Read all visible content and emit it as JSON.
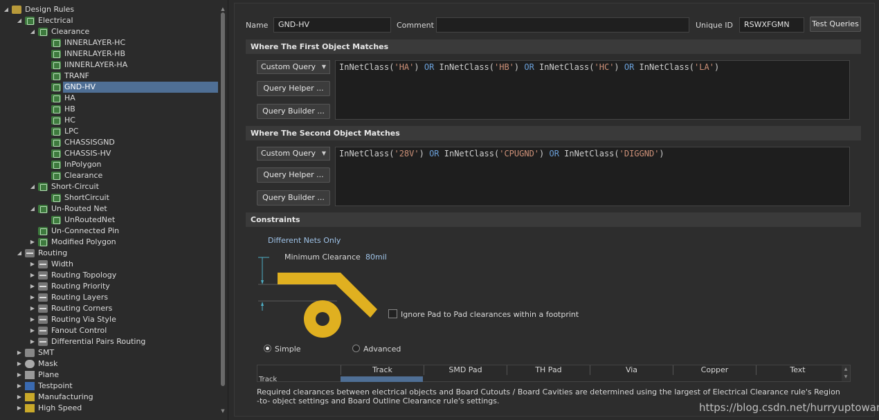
{
  "tree": {
    "root": "Design Rules",
    "electrical": "Electrical",
    "clearance": "Clearance",
    "clearance_rules": [
      "INNERLAYER-HC",
      "INNERLAYER-HB",
      "IINNERLAYER-HA",
      "TRANF",
      "GND-HV",
      "HA",
      "HB",
      "HC",
      "LPC",
      "CHASSISGND",
      "CHASSIS-HV",
      "InPolygon",
      "Clearance"
    ],
    "short_circuit": "Short-Circuit",
    "short_circuit_rule": "ShortCircuit",
    "unrouted_net": "Un-Routed Net",
    "unrouted_net_rule": "UnRoutedNet",
    "unconnected_pin": "Un-Connected Pin",
    "modified_polygon": "Modified Polygon",
    "routing": "Routing",
    "routing_items": [
      "Width",
      "Routing Topology",
      "Routing Priority",
      "Routing Layers",
      "Routing Corners",
      "Routing Via Style",
      "Fanout Control",
      "Differential Pairs Routing"
    ],
    "other_categories": [
      "SMT",
      "Mask",
      "Plane",
      "Testpoint",
      "Manufacturing",
      "High Speed"
    ]
  },
  "header": {
    "name_label": "Name",
    "name_value": "GND-HV",
    "comment_label": "Comment",
    "comment_value": "",
    "uid_label": "Unique ID",
    "uid_value": "RSWXFGMN",
    "test_queries": "Test Queries"
  },
  "first": {
    "title": "Where The First Object Matches",
    "combo": "Custom Query",
    "helper": "Query Helper ...",
    "builder": "Query Builder ...",
    "query": [
      {
        "t": "InNetClass(",
        "c": "kw"
      },
      {
        "t": "'HA'",
        "c": "str"
      },
      {
        "t": ") ",
        "c": "pn"
      },
      {
        "t": "OR",
        "c": "op"
      },
      {
        "t": " InNetClass(",
        "c": "kw"
      },
      {
        "t": "'HB'",
        "c": "str"
      },
      {
        "t": ") ",
        "c": "pn"
      },
      {
        "t": "OR",
        "c": "op"
      },
      {
        "t": " InNetClass(",
        "c": "kw"
      },
      {
        "t": "'HC'",
        "c": "str"
      },
      {
        "t": ") ",
        "c": "pn"
      },
      {
        "t": "OR",
        "c": "op"
      },
      {
        "t": " InNetClass(",
        "c": "kw"
      },
      {
        "t": "'LA'",
        "c": "str"
      },
      {
        "t": ")",
        "c": "pn"
      }
    ]
  },
  "second": {
    "title": "Where The Second Object Matches",
    "combo": "Custom Query",
    "helper": "Query Helper ...",
    "builder": "Query Builder ...",
    "query": [
      {
        "t": "InNetClass(",
        "c": "kw"
      },
      {
        "t": "'28V'",
        "c": "str"
      },
      {
        "t": ") ",
        "c": "pn"
      },
      {
        "t": "OR",
        "c": "op"
      },
      {
        "t": " InNetClass(",
        "c": "kw"
      },
      {
        "t": "'CPUGND'",
        "c": "str"
      },
      {
        "t": ") ",
        "c": "pn"
      },
      {
        "t": "OR",
        "c": "op"
      },
      {
        "t": " InNetClass(",
        "c": "kw"
      },
      {
        "t": "'DIGGND'",
        "c": "str"
      },
      {
        "t": ")",
        "c": "pn"
      }
    ]
  },
  "constraints": {
    "title": "Constraints",
    "net_scope": "Different Nets Only",
    "min_clearance_label": "Minimum Clearance",
    "min_clearance_value": "80mil",
    "ignore_pad": "Ignore Pad to Pad clearances within a footprint",
    "simple": "Simple",
    "advanced": "Advanced",
    "mode": "simple",
    "columns": [
      "Track",
      "SMD Pad",
      "TH Pad",
      "Via",
      "Copper",
      "Text"
    ],
    "first_row_label": "Track",
    "note": "Required clearances between electrical objects and Board Cutouts / Board Cavities are determined using the largest of Electrical Clearance rule's Region -to- object settings and Board Outline Clearance rule's settings."
  },
  "colors": {
    "accent": "#e0b020",
    "selection": "#4f6f95",
    "link": "#9fc3e8"
  },
  "watermark": "https://blog.csdn.net/hurryuptowang"
}
